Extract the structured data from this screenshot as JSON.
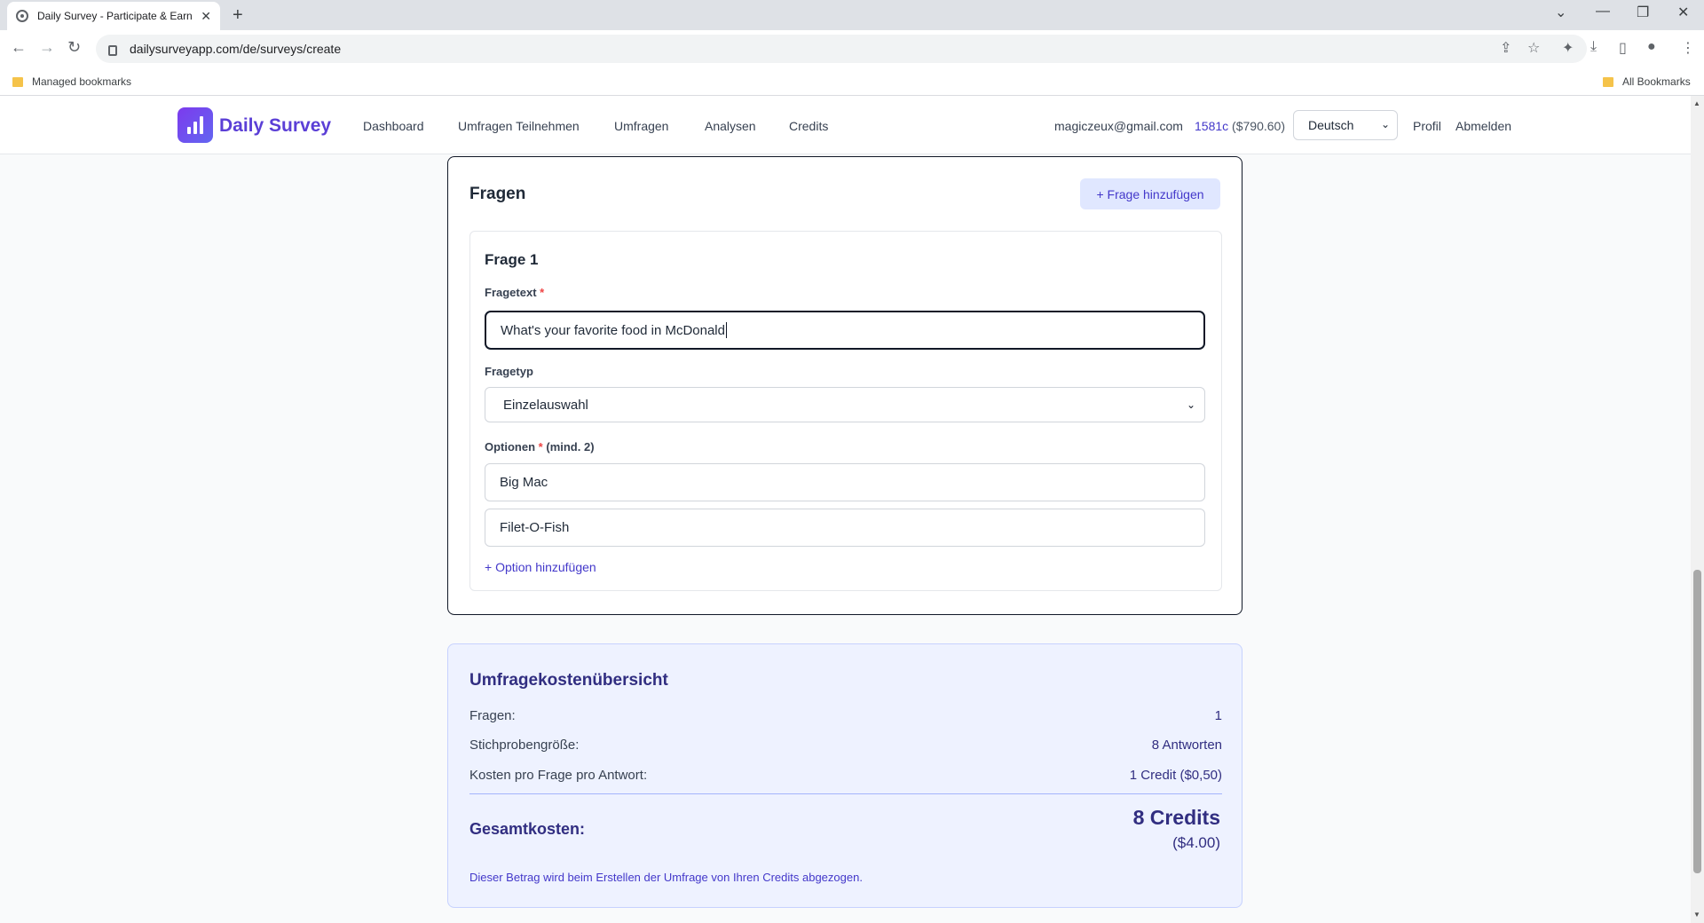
{
  "browser": {
    "tab_title": "Daily Survey - Participate & Earn",
    "url": "dailysurveyapp.com/de/surveys/create",
    "bookmarks": {
      "managed": "Managed bookmarks",
      "all": "All Bookmarks"
    }
  },
  "header": {
    "brand": "Daily Survey",
    "nav": [
      "Dashboard",
      "Umfragen Teilnehmen",
      "Umfragen",
      "Analysen",
      "Credits"
    ],
    "email": "magiczeux@gmail.com",
    "credits": "1581c",
    "credits_usd": "($790.60)",
    "language": "Deutsch",
    "profile": "Profil",
    "logout": "Abmelden"
  },
  "questions": {
    "title": "Fragen",
    "add_button": "+ Frage hinzufügen",
    "items": [
      {
        "heading": "Frage 1",
        "text_label": "Fragetext",
        "text_value": "What's your favorite food in McDonald",
        "type_label": "Fragetyp",
        "type_value": "Einzelauswahl",
        "options_label": "Optionen",
        "options_hint": "(mind. 2)",
        "options": [
          "Big Mac",
          "Filet-O-Fish"
        ],
        "add_option": "+ Option hinzufügen"
      }
    ]
  },
  "cost": {
    "title": "Umfragekostenübersicht",
    "rows": [
      {
        "label": "Fragen:",
        "value": "1"
      },
      {
        "label": "Stichprobengröße:",
        "value": "8 Antworten"
      },
      {
        "label": "Kosten pro Frage pro Antwort:",
        "value": "1 Credit ($0,50)"
      }
    ],
    "total_label": "Gesamtkosten:",
    "total_credits": "8 Credits",
    "total_usd": "($4.00)",
    "note": "Dieser Betrag wird beim Erstellen der Umfrage von Ihren Credits abgezogen."
  },
  "colors": {
    "accent": "#4338ca",
    "brand": "#5b3fd6",
    "cost_bg": "#eef2ff"
  }
}
